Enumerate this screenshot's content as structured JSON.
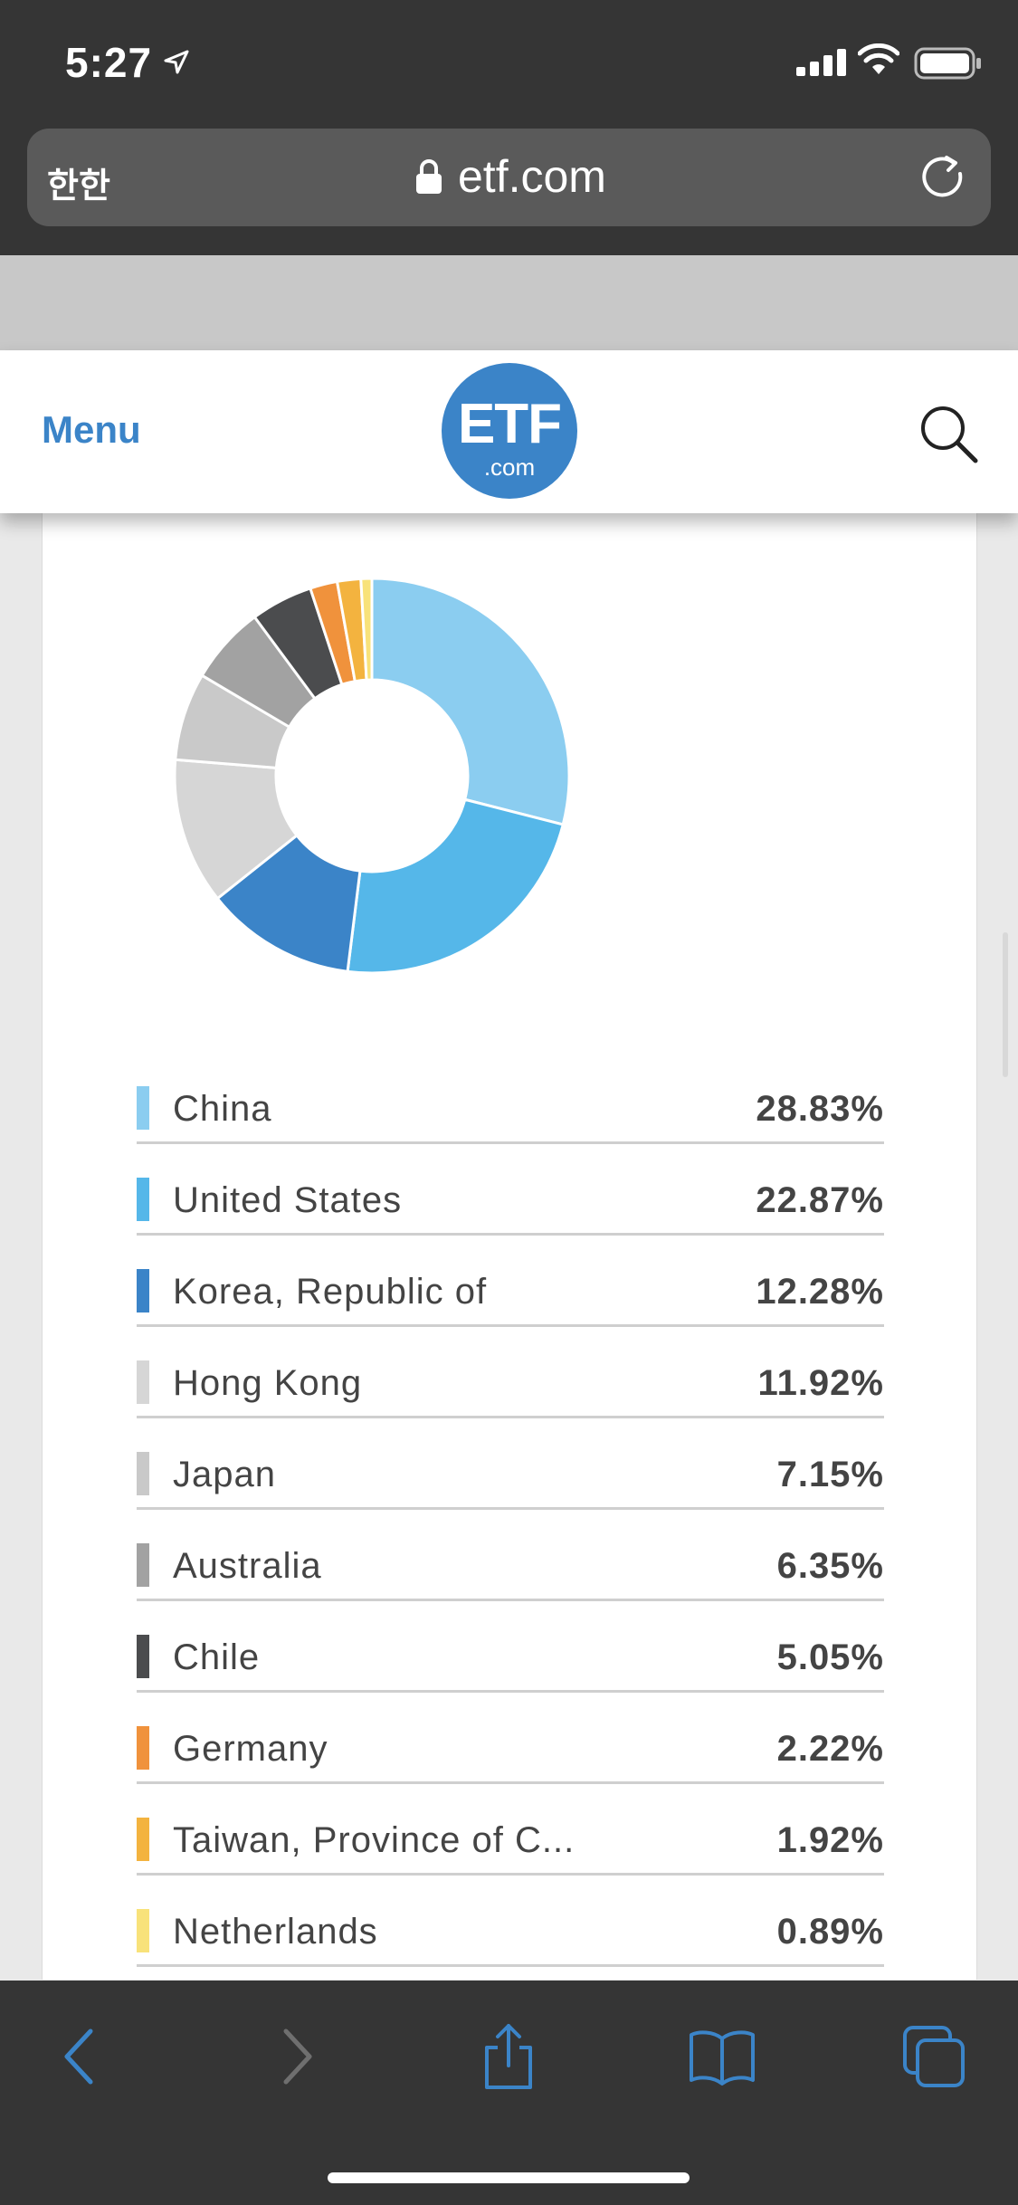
{
  "status_bar": {
    "time": "5:27"
  },
  "url_bar": {
    "text_size_button": "한한",
    "domain": "etf.com"
  },
  "site_header": {
    "menu_label": "Menu",
    "logo_main": "ETF",
    "logo_sub": ".com"
  },
  "chart_data": {
    "type": "pie",
    "categories": [
      "China",
      "United States",
      "Korea, Republic of",
      "Hong Kong",
      "Japan",
      "Australia",
      "Chile",
      "Germany",
      "Taiwan, Province of C...",
      "Netherlands"
    ],
    "values": [
      28.83,
      22.87,
      12.28,
      11.92,
      7.15,
      6.35,
      5.05,
      2.22,
      1.92,
      0.89
    ],
    "colors": [
      "#8bcdf0",
      "#55b7e9",
      "#3b84c8",
      "#d6d6d6",
      "#c9c9c9",
      "#a2a2a2",
      "#4b4c4e",
      "#f0923c",
      "#f3b33f",
      "#f8e27a"
    ],
    "display_values": [
      "28.83%",
      "22.87%",
      "12.28%",
      "11.92%",
      "7.15%",
      "6.35%",
      "5.05%",
      "2.22%",
      "1.92%",
      "0.89%"
    ],
    "donut": true,
    "start": "12 o'clock, clockwise"
  },
  "toolbar": {
    "icons": [
      "back-icon",
      "forward-icon",
      "share-icon",
      "bookmarks-icon",
      "tabs-icon"
    ],
    "accent": "#3b84c8",
    "disabled": "#6f6f6f"
  }
}
